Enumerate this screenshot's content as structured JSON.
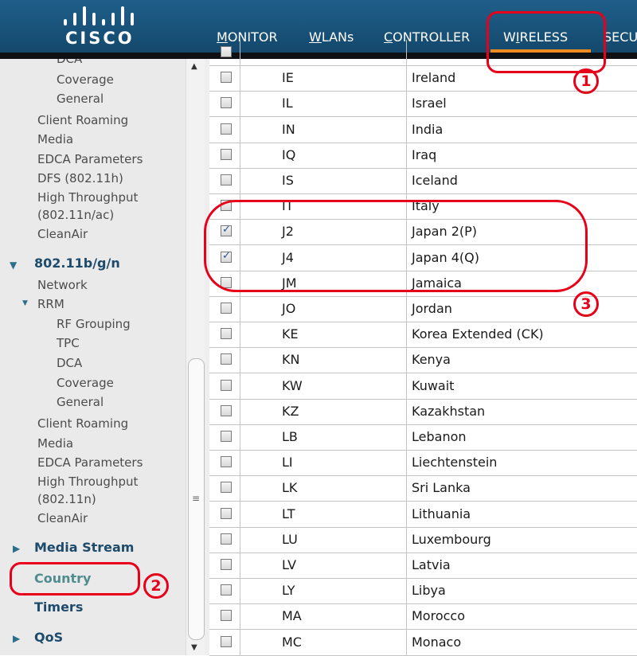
{
  "header": {
    "logo_text": "CISCO",
    "nav": [
      {
        "key": "M",
        "rest": "ONITOR"
      },
      {
        "key": "W",
        "rest": "LANs"
      },
      {
        "key": "C",
        "rest": "ONTROLLER"
      },
      {
        "key": "",
        "mid_pre": "W",
        "mid_key": "I",
        "mid_rest": "RELESS"
      },
      {
        "key": "",
        "rest": "SECU"
      }
    ],
    "active_color": "#f08c1f"
  },
  "sidebar": {
    "top_items": [
      "DCA",
      "Coverage",
      "General",
      "Client Roaming",
      "Media",
      "EDCA Parameters",
      "DFS (802.11h)",
      "High Throughput",
      "(802.11n/ac)",
      "CleanAir"
    ],
    "section_bgn": "802.11b/g/n",
    "bgn_items": [
      "Network",
      "RRM",
      "RF Grouping",
      "TPC",
      "DCA",
      "Coverage",
      "General",
      "Client Roaming",
      "Media",
      "EDCA Parameters",
      "High Throughput",
      "(802.11n)",
      "CleanAir"
    ],
    "media_stream": "Media Stream",
    "country": "Country",
    "timers": "Timers",
    "qos": "QoS"
  },
  "countries": [
    {
      "code": "",
      "name": "",
      "checked": false
    },
    {
      "code": "IE",
      "name": "Ireland",
      "checked": false
    },
    {
      "code": "IL",
      "name": "Israel",
      "checked": false
    },
    {
      "code": "IN",
      "name": "India",
      "checked": false
    },
    {
      "code": "IQ",
      "name": "Iraq",
      "checked": false
    },
    {
      "code": "IS",
      "name": "Iceland",
      "checked": false
    },
    {
      "code": "IT",
      "name": "Italy",
      "checked": false
    },
    {
      "code": "J2",
      "name": "Japan 2(P)",
      "checked": true
    },
    {
      "code": "J4",
      "name": "Japan 4(Q)",
      "checked": true
    },
    {
      "code": "JM",
      "name": "Jamaica",
      "checked": false
    },
    {
      "code": "JO",
      "name": "Jordan",
      "checked": false
    },
    {
      "code": "KE",
      "name": "Korea Extended (CK)",
      "checked": false
    },
    {
      "code": "KN",
      "name": "Kenya",
      "checked": false
    },
    {
      "code": "KW",
      "name": "Kuwait",
      "checked": false
    },
    {
      "code": "KZ",
      "name": "Kazakhstan",
      "checked": false
    },
    {
      "code": "LB",
      "name": "Lebanon",
      "checked": false
    },
    {
      "code": "LI",
      "name": "Liechtenstein",
      "checked": false
    },
    {
      "code": "LK",
      "name": "Sri Lanka",
      "checked": false
    },
    {
      "code": "LT",
      "name": "Lithuania",
      "checked": false
    },
    {
      "code": "LU",
      "name": "Luxembourg",
      "checked": false
    },
    {
      "code": "LV",
      "name": "Latvia",
      "checked": false
    },
    {
      "code": "LY",
      "name": "Libya",
      "checked": false
    },
    {
      "code": "MA",
      "name": "Morocco",
      "checked": false
    },
    {
      "code": "MC",
      "name": "Monaco",
      "checked": false
    }
  ],
  "annotations": {
    "one": "1",
    "two": "2",
    "three": "3",
    "color": "#e8001b"
  }
}
